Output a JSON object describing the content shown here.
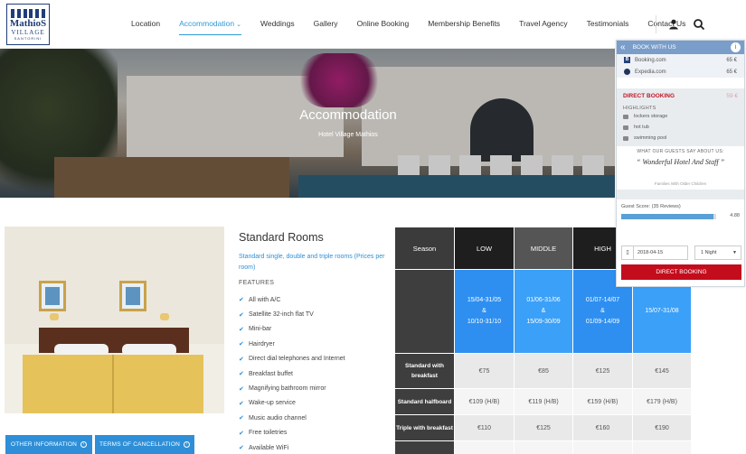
{
  "logo": {
    "line1": "MathioS",
    "line2": "VILLAGE",
    "line3": "SANTORINI"
  },
  "nav": {
    "items": [
      "Location",
      "Accommodation",
      "Weddings",
      "Gallery",
      "Online Booking",
      "Membership Benefits",
      "Travel Agency",
      "Testimonials",
      "Contact Us"
    ],
    "active": "Accommodation"
  },
  "header_icons": [
    "user-icon",
    "search-icon"
  ],
  "hero": {
    "title": "Accommodation",
    "subtitle": "Hotel Village Mathios"
  },
  "room": {
    "title": "Standard Rooms",
    "description": "Standard single, double and triple rooms (Prices per room)",
    "features_label": "FEATURES",
    "features": [
      "All with A/C",
      "Satellite 32-inch flat TV",
      "Mini-bar",
      "Hairdryer",
      "Direct dial telephones and Internet",
      "Breakfast buffet",
      "Magnifying bathroom mirror",
      "Wake-up service",
      "Music audio channel",
      "Free toiletries",
      "Available WiFi"
    ]
  },
  "buttons": {
    "other_info": "OTHER INFORMATION",
    "terms": "TERMS OF CANCELLATION"
  },
  "price_table": {
    "headers": [
      "Season",
      "LOW",
      "MIDDLE",
      "HIGH",
      ""
    ],
    "dates": [
      [
        "15/04-31/05",
        "&",
        "10/10-31/10"
      ],
      [
        "01/06-31/06",
        "&",
        "15/09-30/09"
      ],
      [
        "01/07-14/07",
        "&",
        "01/09-14/09"
      ],
      [
        "15/07-31/08"
      ]
    ],
    "rows": [
      {
        "label": "Standard with breakfast",
        "values": [
          "€75",
          "€85",
          "€125",
          "€145"
        ]
      },
      {
        "label": "Standard halfboard",
        "values": [
          "€109 (H/B)",
          "€119 (H/B)",
          "€159 (H/B)",
          "€179 (H/B)"
        ]
      },
      {
        "label": "Triple with breakfast",
        "values": [
          "€110",
          "€125",
          "€160",
          "€190"
        ]
      }
    ]
  },
  "widget": {
    "title": "BOOK WITH US",
    "ota": [
      {
        "name": "Booking.com",
        "price": "65 €"
      },
      {
        "name": "Expedia.com",
        "price": "65 €"
      }
    ],
    "direct": {
      "label": "DIRECT BOOKING",
      "price": "59 €"
    },
    "highlights_label": "HIGHLIGHTS",
    "highlights": [
      "lockers storage",
      "hot tub",
      "swimming pool"
    ],
    "quote_label": "WHAT OUR GUESTS SAY ABOUT US:",
    "quote": "Wonderful Hotel And Staff",
    "quote_source": "Families With Older Children",
    "score_label": "Guest Score: (35 Reviews)",
    "score": 4.88,
    "score_max": 5,
    "date": "2018-04-15",
    "nights": "1 Night",
    "book_label": "DIRECT BOOKING"
  },
  "colors": {
    "accent": "#2e8fd8",
    "brand": "#1f3d7a",
    "booking_red": "#c30d1d"
  }
}
